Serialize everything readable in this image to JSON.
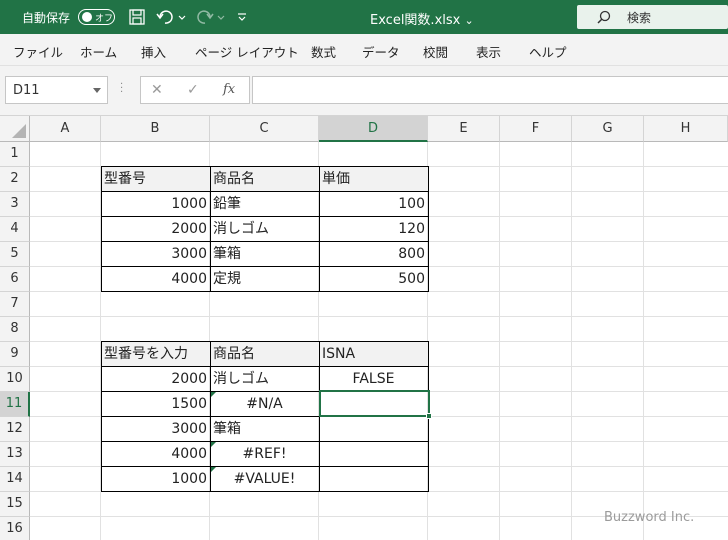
{
  "titlebar": {
    "autosave_label": "自動保存",
    "autosave_toggle": "オフ",
    "doc_title": "Excel関数.xlsx",
    "doc_title_caret": "⌄",
    "search_label": "検索"
  },
  "ribbon": {
    "tabs": [
      "ファイル",
      "ホーム",
      "挿入",
      "ページ レイアウト",
      "数式",
      "データ",
      "校閲",
      "表示",
      "ヘルプ"
    ]
  },
  "formula_bar": {
    "name_box": "D11",
    "cancel_icon": "✕",
    "enter_icon": "✓",
    "fx_label": "fx",
    "formula": ""
  },
  "columns": [
    "A",
    "B",
    "C",
    "D",
    "E",
    "F",
    "G",
    "H"
  ],
  "rows": [
    "1",
    "2",
    "3",
    "4",
    "5",
    "6",
    "7",
    "8",
    "9",
    "10",
    "11",
    "12",
    "13",
    "14",
    "15",
    "16"
  ],
  "selected": {
    "column": "D",
    "row": "11"
  },
  "table1": {
    "headers": [
      "型番号",
      "商品名",
      "単価"
    ],
    "rows": [
      [
        "1000",
        "鉛筆",
        "100"
      ],
      [
        "2000",
        "消しゴム",
        "120"
      ],
      [
        "3000",
        "筆箱",
        "800"
      ],
      [
        "4000",
        "定規",
        "500"
      ]
    ]
  },
  "table2": {
    "headers": [
      "型番号を入力",
      "商品名",
      "ISNA"
    ],
    "rows": [
      [
        "2000",
        "消しゴム",
        "FALSE"
      ],
      [
        "1500",
        "#N/A",
        ""
      ],
      [
        "3000",
        "筆箱",
        ""
      ],
      [
        "4000",
        "#REF!",
        ""
      ],
      [
        "1000",
        "#VALUE!",
        ""
      ]
    ]
  },
  "watermark": "Buzzword Inc.",
  "colors": {
    "accent": "#217346",
    "header_bg": "#f3f3f3"
  }
}
